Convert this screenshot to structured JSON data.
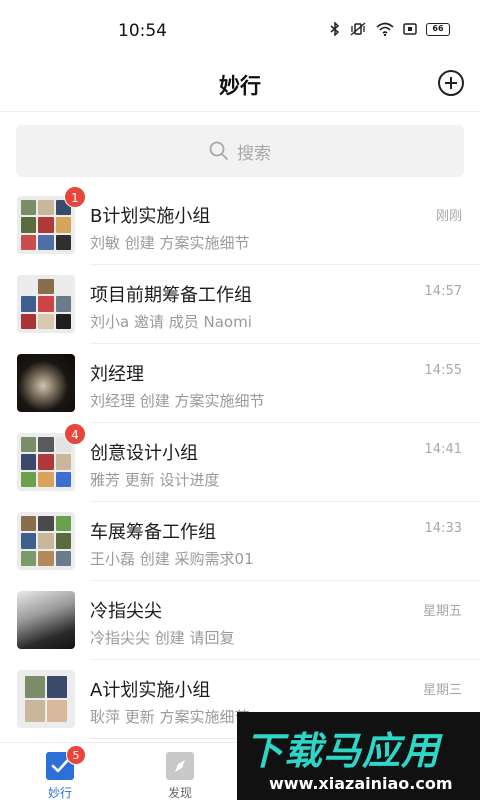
{
  "status_bar": {
    "time": "10:54",
    "battery": "66"
  },
  "header": {
    "title": "妙行"
  },
  "search": {
    "placeholder": "搜索"
  },
  "chats": [
    {
      "name": "B计划实施小组",
      "preview": "刘敏 创建 方案实施细节",
      "time": "刚刚",
      "badge": "1",
      "avatar": "group"
    },
    {
      "name": "项目前期筹备工作组",
      "preview": "刘小a 邀请 成员 Naomi",
      "time": "14:57",
      "badge": "",
      "avatar": "group"
    },
    {
      "name": "刘经理",
      "preview": "刘经理 创建 方案实施细节",
      "time": "14:55",
      "badge": "",
      "avatar": "photo"
    },
    {
      "name": "创意设计小组",
      "preview": "雅芳 更新 设计进度",
      "time": "14:41",
      "badge": "4",
      "avatar": "group"
    },
    {
      "name": "车展筹备工作组",
      "preview": "王小磊 创建 采购需求01",
      "time": "14:33",
      "badge": "",
      "avatar": "group"
    },
    {
      "name": "冷指尖尖",
      "preview": "冷指尖尖 创建 请回复",
      "time": "星期五",
      "badge": "",
      "avatar": "photo"
    },
    {
      "name": "A计划实施小组",
      "preview": "耿萍 更新 方案实施细节",
      "time": "星期三",
      "badge": "",
      "avatar": "group"
    }
  ],
  "tabs": [
    {
      "label": "妙行",
      "icon": "check-square-icon",
      "badge": "5",
      "active": true
    },
    {
      "label": "发现",
      "icon": "compass-icon",
      "badge": "",
      "active": false
    }
  ],
  "watermark": {
    "title": "下载马应用",
    "url": "www.xiazainiao.com"
  }
}
